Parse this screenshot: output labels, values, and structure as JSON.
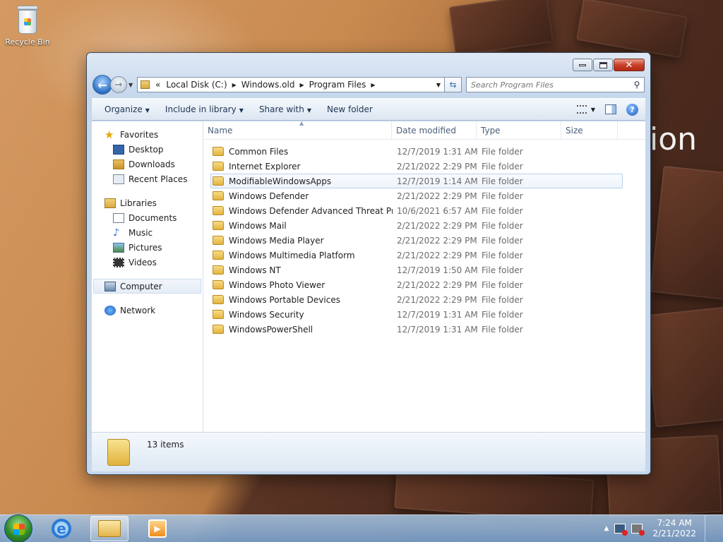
{
  "desktop": {
    "recycle_bin_label": "Recycle Bin",
    "wallpaper_text": "ion"
  },
  "address_bar": {
    "overflow": "«",
    "crumbs": [
      "Local Disk (C:)",
      "Windows.old",
      "Program Files"
    ],
    "search_placeholder": "Search Program Files"
  },
  "toolbar": {
    "organize": "Organize",
    "include_in_library": "Include in library",
    "share_with": "Share with",
    "new_folder": "New folder"
  },
  "nav_pane": {
    "favorites": "Favorites",
    "favorites_items": [
      "Desktop",
      "Downloads",
      "Recent Places"
    ],
    "libraries": "Libraries",
    "library_items": [
      "Documents",
      "Music",
      "Pictures",
      "Videos"
    ],
    "computer": "Computer",
    "network": "Network"
  },
  "columns": {
    "name": "Name",
    "date_modified": "Date modified",
    "type": "Type",
    "size": "Size"
  },
  "files": [
    {
      "name": "Common Files",
      "date": "12/7/2019 1:31 AM",
      "type": "File folder"
    },
    {
      "name": "Internet Explorer",
      "date": "2/21/2022 2:29 PM",
      "type": "File folder"
    },
    {
      "name": "ModifiableWindowsApps",
      "date": "12/7/2019 1:14 AM",
      "type": "File folder"
    },
    {
      "name": "Windows Defender",
      "date": "2/21/2022 2:29 PM",
      "type": "File folder"
    },
    {
      "name": "Windows Defender Advanced Threat Pro...",
      "date": "10/6/2021 6:57 AM",
      "type": "File folder"
    },
    {
      "name": "Windows Mail",
      "date": "2/21/2022 2:29 PM",
      "type": "File folder"
    },
    {
      "name": "Windows Media Player",
      "date": "2/21/2022 2:29 PM",
      "type": "File folder"
    },
    {
      "name": "Windows Multimedia Platform",
      "date": "2/21/2022 2:29 PM",
      "type": "File folder"
    },
    {
      "name": "Windows NT",
      "date": "12/7/2019 1:50 AM",
      "type": "File folder"
    },
    {
      "name": "Windows Photo Viewer",
      "date": "2/21/2022 2:29 PM",
      "type": "File folder"
    },
    {
      "name": "Windows Portable Devices",
      "date": "2/21/2022 2:29 PM",
      "type": "File folder"
    },
    {
      "name": "Windows Security",
      "date": "12/7/2019 1:31 AM",
      "type": "File folder"
    },
    {
      "name": "WindowsPowerShell",
      "date": "12/7/2019 1:31 AM",
      "type": "File folder"
    }
  ],
  "status": {
    "item_count": "13 items"
  },
  "taskbar": {
    "time": "7:24 AM",
    "date": "2/21/2022"
  },
  "icons": {
    "back": "back-arrow-icon",
    "forward": "forward-arrow-icon",
    "refresh": "refresh-icon",
    "search": "search-icon",
    "help": "help-icon"
  }
}
